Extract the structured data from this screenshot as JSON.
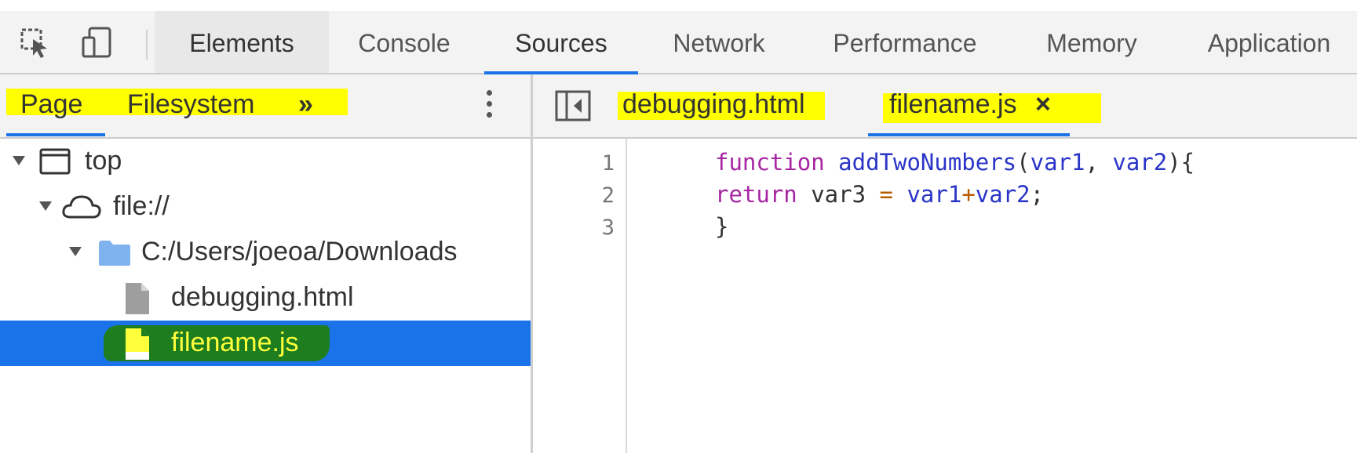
{
  "main_tabs": [
    "Elements",
    "Console",
    "Sources",
    "Network",
    "Performance",
    "Memory",
    "Application"
  ],
  "navigator": {
    "tabs": [
      "Page",
      "Filesystem",
      "»"
    ],
    "tree": {
      "top": "top",
      "origin": "file://",
      "folder": "C:/Users/joeoa/Downloads",
      "files": [
        "debugging.html",
        "filename.js"
      ]
    }
  },
  "editor": {
    "tabs": [
      "debugging.html",
      "filename.js"
    ],
    "close_glyph": "×",
    "line_numbers": [
      "1",
      "2",
      "3"
    ],
    "code": {
      "l1_kw": "function",
      "l1_fn": "addTwoNumbers",
      "l1_open": "(",
      "l1_a": "var1",
      "l1_comma": ", ",
      "l1_b": "var2",
      "l1_close": "){",
      "l2_kw": "return",
      "l2_v3": " var3 ",
      "l2_eq": "=",
      "l2_a": "var1",
      "l2_plus": "+",
      "l2_b": "var2",
      "l2_semi": ";",
      "l3": "}"
    }
  },
  "colors": {
    "accent": "#1a73e8",
    "highlight_yellow": "#ffff00",
    "highlight_green": "#1e7d1e",
    "keyword": "#a626a4",
    "identifier": "#2a35c7"
  },
  "icons": [
    "inspect-element-icon",
    "device-toolbar-icon",
    "kebab-menu-icon",
    "toggle-navigator-icon",
    "frame-icon",
    "cloud-icon",
    "folder-icon",
    "file-icon",
    "close-icon"
  ]
}
